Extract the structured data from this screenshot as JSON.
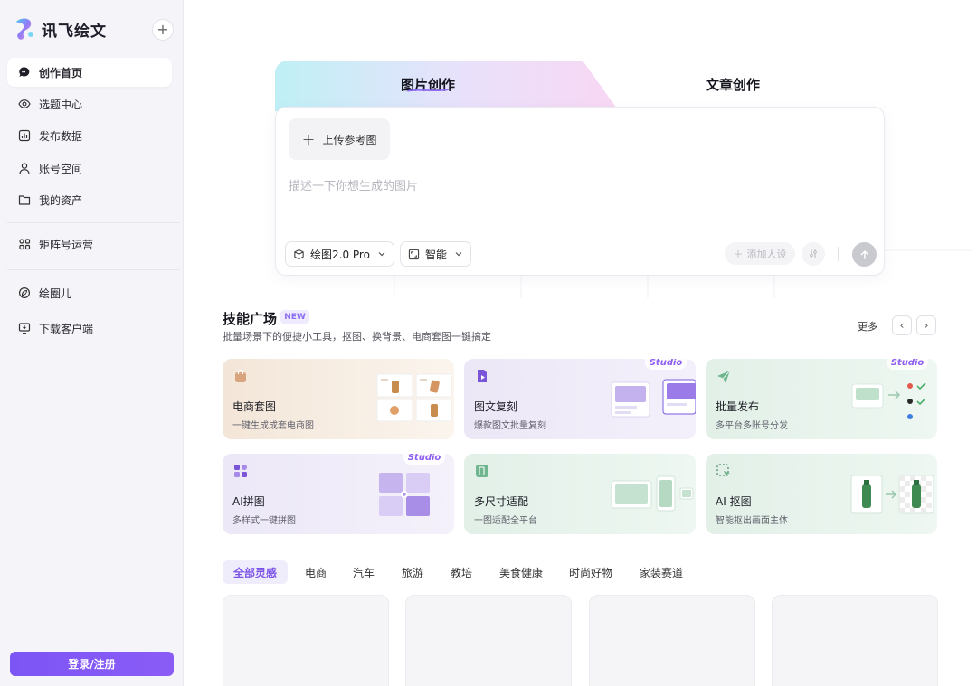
{
  "app": {
    "brand_name": "讯飞绘文",
    "new_button": "+"
  },
  "sidebar": {
    "items": [
      {
        "label": "创作首页",
        "icon": "chat-bubble-icon",
        "active": true
      },
      {
        "label": "选题中心",
        "icon": "eye-icon"
      },
      {
        "label": "发布数据",
        "icon": "bar-chart-icon"
      },
      {
        "label": "账号空间",
        "icon": "user-icon"
      },
      {
        "label": "我的资产",
        "icon": "folder-icon"
      },
      {
        "label": "矩阵号运营",
        "icon": "grid-nodes-icon"
      },
      {
        "label": "绘圈儿",
        "icon": "circle-leaf-icon"
      },
      {
        "label": "下载客户端",
        "icon": "monitor-download-icon"
      }
    ],
    "login_label": "登录/注册"
  },
  "composer": {
    "tabs": [
      {
        "label": "图片创作",
        "active": true
      },
      {
        "label": "文章创作",
        "active": false
      }
    ],
    "upload_label": "上传参考图",
    "prompt_placeholder": "描述一下你想生成的图片",
    "model_label": "绘图2.0 Pro",
    "ratio_label": "智能",
    "persona_label": "添加人设"
  },
  "skills": {
    "title": "技能广场",
    "badge": "NEW",
    "subtitle": "批量场景下的便捷小工具，抠图、换背景、电商套图一键搞定",
    "more_label": "更多",
    "studio_label": "Studio",
    "cards": [
      {
        "name": "电商套图",
        "desc": "一键生成成套电商图",
        "studio": false
      },
      {
        "name": "图文复刻",
        "desc": "爆款图文批量复刻",
        "studio": true
      },
      {
        "name": "批量发布",
        "desc": "多平台多账号分发",
        "studio": true
      },
      {
        "name": "AI拼图",
        "desc": "多样式一键拼图",
        "studio": true
      },
      {
        "name": "多尺寸适配",
        "desc": "一图适配全平台",
        "studio": false
      },
      {
        "name": "AI 抠图",
        "desc": "智能抠出画面主体",
        "studio": false
      }
    ]
  },
  "categories": [
    "全部灵感",
    "电商",
    "汽车",
    "旅游",
    "教培",
    "美食健康",
    "时尚好物",
    "家装赛道"
  ],
  "colors": {
    "accent": "#7c55f5",
    "sidebar_bg": "#f5f4f8",
    "studio_text": "#8e5ef0"
  }
}
